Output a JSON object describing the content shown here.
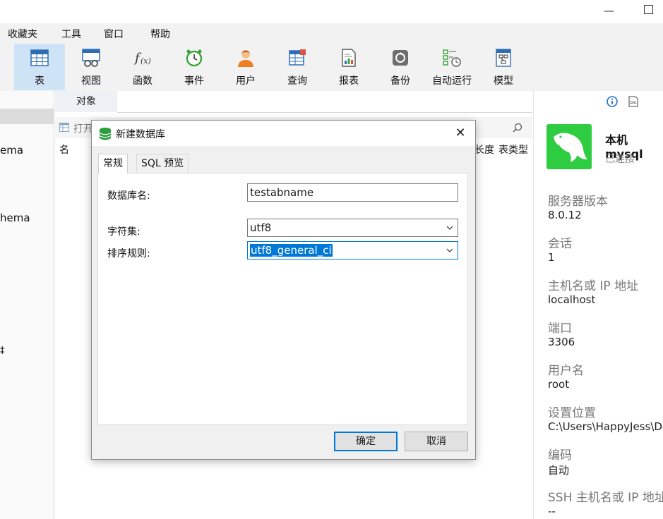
{
  "menu": [
    "收藏夹",
    "工具",
    "窗口",
    "帮助"
  ],
  "toolbar": [
    {
      "label": "表",
      "icon": "table-icon",
      "active": true
    },
    {
      "label": "视图",
      "icon": "view-icon",
      "active": false
    },
    {
      "label": "函数",
      "icon": "function-icon",
      "active": false
    },
    {
      "label": "事件",
      "icon": "event-clock-icon",
      "active": false
    },
    {
      "label": "用户",
      "icon": "user-icon",
      "active": false
    },
    {
      "label": "查询",
      "icon": "query-icon",
      "active": false
    },
    {
      "label": "报表",
      "icon": "report-icon",
      "active": false
    },
    {
      "label": "备份",
      "icon": "backup-icon",
      "active": false
    },
    {
      "label": "自动运行",
      "icon": "automation-icon",
      "active": false
    },
    {
      "label": "模型",
      "icon": "model-icon",
      "active": false
    }
  ],
  "left": {
    "items": [
      "ema",
      "hema",
      "‡"
    ]
  },
  "center": {
    "tab_label": "对象",
    "open_label": "打开",
    "col_name": "名",
    "col_length": "长度",
    "col_type": "表类型"
  },
  "right": {
    "conn_name": "本机mysql",
    "conn_status": "已连接",
    "fields": [
      {
        "label": "服务器版本",
        "value": "8.0.12"
      },
      {
        "label": "会话",
        "value": "1"
      },
      {
        "label": "主机名或 IP 地址",
        "value": "localhost"
      },
      {
        "label": "端口",
        "value": "3306"
      },
      {
        "label": "用户名",
        "value": "root"
      },
      {
        "label": "设置位置",
        "value": "C:\\Users\\HappyJess\\Do"
      },
      {
        "label": "编码",
        "value": "自动"
      },
      {
        "label": "SSH 主机名或 IP 地址",
        "value": "--"
      }
    ]
  },
  "dialog": {
    "title": "新建数据库",
    "tabs": [
      "常规",
      "SQL 预览"
    ],
    "db_name_label": "数据库名:",
    "db_name_value": "testabname",
    "charset_label": "字符集:",
    "charset_value": "utf8",
    "collation_label": "排序规则:",
    "collation_value": "utf8_general_ci",
    "ok_label": "确定",
    "cancel_label": "取消"
  },
  "colors": {
    "accent": "#0078d7",
    "active_tool_bg": "#cfe3f7",
    "mysql_green": "#2ecc40"
  }
}
